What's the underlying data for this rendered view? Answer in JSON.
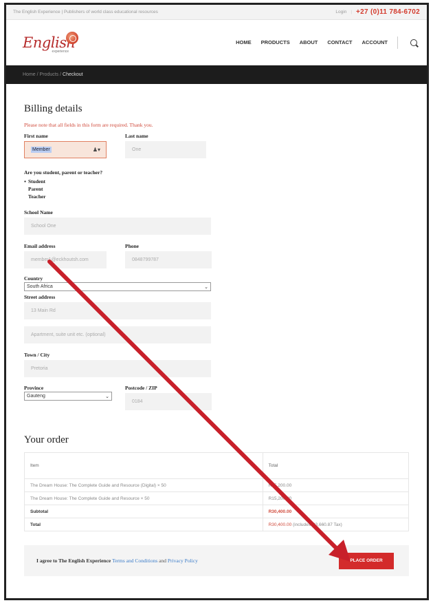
{
  "topbar": {
    "tagline": "The English Experience | Publishers of world class educational resources",
    "login": "Login",
    "phone": "+27 (0)11 784-6702"
  },
  "logo": {
    "word": "English",
    "sub": "experience"
  },
  "nav": {
    "items": [
      "HOME",
      "PRODUCTS",
      "ABOUT",
      "CONTACT",
      "ACCOUNT"
    ]
  },
  "breadcrumb": {
    "home": "Home",
    "sep1": "/",
    "products": "Products",
    "sep2": "/",
    "current": "Checkout"
  },
  "billing": {
    "title": "Billing details",
    "notice": "Please note that all fields in this form are required. Thank you.",
    "first_name": {
      "label": "First name",
      "value": "Member"
    },
    "last_name": {
      "label": "Last name",
      "value": "One"
    },
    "role": {
      "label": "Are you student, parent or teacher?",
      "options": [
        "Student",
        "Parent",
        "Teacher"
      ],
      "selected": "Student"
    },
    "school": {
      "label": "School Name",
      "value": "School One"
    },
    "email": {
      "label": "Email address",
      "value": "member1@eckhoutsh.com"
    },
    "phone": {
      "label": "Phone",
      "value": "0848799787"
    },
    "country": {
      "label": "Country",
      "value": "South Africa"
    },
    "street": {
      "label": "Street address",
      "value": "13 Main Rd",
      "placeholder2": "Apartment, suite unit etc. (optional)"
    },
    "town": {
      "label": "Town / City",
      "value": "Pretoria"
    },
    "province": {
      "label": "Province",
      "value": "Gauteng"
    },
    "postcode": {
      "label": "Postcode / ZIP",
      "value": "0184"
    }
  },
  "order": {
    "title": "Your order",
    "col_item": "Item",
    "col_total": "Total",
    "items": [
      {
        "name": "The Dream House: The Complete Guide and Resource (Digital) × 50",
        "total": "R15,200.00"
      },
      {
        "name": "The Dream House: The Complete Guide and Resource × 50",
        "total": "R15,200.00"
      }
    ],
    "subtotal_label": "Subtotal",
    "subtotal": "R30,400.00",
    "total_label": "Total",
    "total": "R30,400.00",
    "tax_note": "(includes R3,660.87 Tax)"
  },
  "terms": {
    "prefix": "I agree to The English Experience",
    "terms_link": "Terms and Conditions",
    "and": "and",
    "privacy_link": "Privacy Policy"
  },
  "place_order": "PLACE ORDER",
  "colors": {
    "accent_red": "#d32b2b",
    "annotation_arrow": "#c8202a",
    "dark_bar": "#1c1c1c"
  }
}
